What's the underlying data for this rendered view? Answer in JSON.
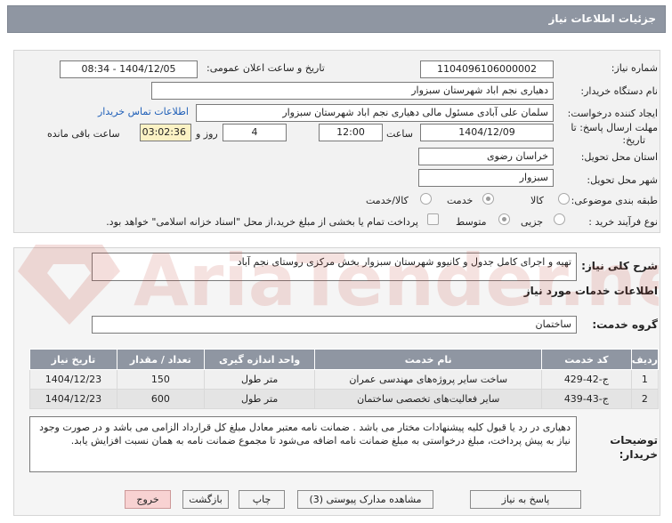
{
  "window": {
    "title": "جزئیات اطلاعات نیاز"
  },
  "fields": {
    "need_number_label": "شماره نیاز:",
    "need_number": "1104096106000002",
    "announce_label": "تاریخ و ساعت اعلان عمومی:",
    "announce_value": "1404/12/05 - 08:34",
    "buyer_org_label": "نام دستگاه خریدار:",
    "buyer_org": "دهیاری نجم اباد شهرستان سبزوار",
    "requester_label": "ایجاد کننده درخواست:",
    "requester": "سلمان علی آبادی مسئول مالی دهیاری نجم اباد شهرستان سبزوار",
    "contact_link": "اطلاعات تماس خریدار",
    "deadline_label_1": "مهلت ارسال پاسخ: تا",
    "deadline_label_2": "تاریخ:",
    "deadline_date": "1404/12/09",
    "time_label": "ساعت",
    "deadline_time": "12:00",
    "days": "4",
    "days_label": "روز و",
    "remaining_time": "03:02:36",
    "remaining_label": "ساعت باقی مانده",
    "province_label": "استان محل تحویل:",
    "province": "خراسان رضوی",
    "city_label": "شهر محل تحویل:",
    "city": "سبزوار",
    "category_label": "طبقه بندی موضوعی:",
    "category_options": [
      "کالا",
      "خدمت",
      "کالا/خدمت"
    ],
    "process_label": "نوع فرآیند خرید :",
    "process_options": [
      "جزیی",
      "متوسط"
    ],
    "payment_note": "پرداخت تمام یا بخشی از مبلغ خرید،از محل \"اسناد خزانه اسلامی\" خواهد بود."
  },
  "details": {
    "summary_label": "شرح کلی نیاز:",
    "summary": "تهیه و اجرای کامل جدول و کانیوو شهرستان سبزوار بخش مرکزی روستای نجم آباد",
    "services_heading": "اطلاعات خدمات مورد نیاز",
    "service_group_label": "گروه خدمت:",
    "service_group": "ساختمان",
    "buyer_notes_label_1": "توضیحات",
    "buyer_notes_label_2": "خریدار:",
    "buyer_notes": "دهیاری در رد یا قبول کلیه پیشنهادات مختار می باشد . ضمانت نامه معتبر معادل مبلغ کل قرارداد الزامی می باشد و در صورت وجود نیاز به پیش پرداخت، مبلغ درخواستی به مبلغ ضمانت نامه اضافه می‌شود تا مجموع ضمانت نامه به همان نسبت افزایش یابد."
  },
  "table": {
    "headers": [
      "ردیف",
      "کد خدمت",
      "نام خدمت",
      "واحد اندازه گیری",
      "تعداد / مقدار",
      "تاریخ نیاز"
    ],
    "rows": [
      [
        "1",
        "ج-42-429",
        "ساخت سایر پروژه‌های مهندسی عمران",
        "متر طول",
        "150",
        "1404/12/23"
      ],
      [
        "2",
        "ج-43-439",
        "سایر فعالیت‌های تخصصی ساختمان",
        "متر طول",
        "600",
        "1404/12/23"
      ]
    ]
  },
  "buttons": {
    "reply": "پاسخ به نیاز",
    "docs": "مشاهده مدارک پیوستی (3)",
    "print": "چاپ",
    "back": "بازگشت",
    "exit": "خروج"
  },
  "watermark": {
    "text": "AriaTender.neT"
  },
  "colors": {
    "header_bg": "#8f96a2",
    "link": "#1f5fb8",
    "highlight": "#fbf2c4",
    "exit_btn": "#f8d2d2"
  }
}
